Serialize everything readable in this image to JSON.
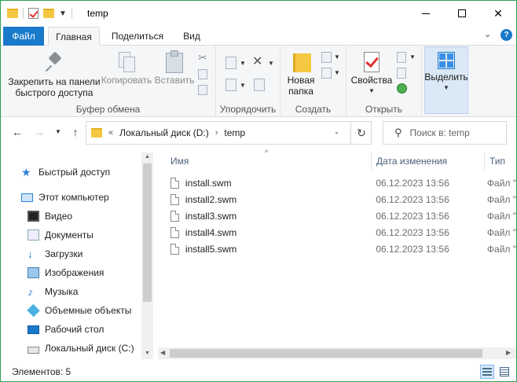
{
  "window": {
    "title": "temp",
    "border_color": "#2c9f4f"
  },
  "ribbon_tabs": {
    "file": "Файл",
    "home": "Главная",
    "share": "Поделиться",
    "view": "Вид",
    "accent": "#1979ca"
  },
  "ribbon": {
    "clipboard": {
      "label": "Буфер обмена",
      "pin_line1": "Закрепить на панели",
      "pin_line2": "быстрого доступа",
      "copy": "Копировать",
      "paste": "Вставить"
    },
    "organize": {
      "label": "Упорядочить"
    },
    "new": {
      "label": "Создать",
      "folder_line1": "Новая",
      "folder_line2": "папка"
    },
    "open": {
      "label": "Открыть",
      "properties": "Свойства"
    },
    "select": {
      "label": "Выделить"
    }
  },
  "address": {
    "prefix": "«",
    "crumbs": [
      "Локальный диск (D:)",
      "temp"
    ],
    "separator": "›"
  },
  "search": {
    "placeholder": "Поиск в: temp"
  },
  "nav": {
    "items": [
      {
        "label": "Быстрый доступ",
        "icon": "star-icon"
      },
      {
        "label": "Этот компьютер",
        "icon": "computer-icon"
      },
      {
        "label": "Видео",
        "icon": "video-icon"
      },
      {
        "label": "Документы",
        "icon": "documents-icon"
      },
      {
        "label": "Загрузки",
        "icon": "downloads-icon"
      },
      {
        "label": "Изображения",
        "icon": "pictures-icon"
      },
      {
        "label": "Музыка",
        "icon": "music-icon"
      },
      {
        "label": "Объемные объекты",
        "icon": "3d-objects-icon"
      },
      {
        "label": "Рабочий стол",
        "icon": "desktop-icon"
      },
      {
        "label": "Локальный диск (C:)",
        "icon": "disk-icon"
      }
    ]
  },
  "columns": {
    "name": "Имя",
    "date": "Дата изменения",
    "type": "Тип"
  },
  "files": [
    {
      "name": "install.swm",
      "date": "06.12.2023 13:56",
      "type": "Файл \""
    },
    {
      "name": "install2.swm",
      "date": "06.12.2023 13:56",
      "type": "Файл \""
    },
    {
      "name": "install3.swm",
      "date": "06.12.2023 13:56",
      "type": "Файл \""
    },
    {
      "name": "install4.swm",
      "date": "06.12.2023 13:56",
      "type": "Файл \""
    },
    {
      "name": "install5.swm",
      "date": "06.12.2023 13:56",
      "type": "Файл \""
    }
  ],
  "status": {
    "items_count": "Элементов: 5"
  }
}
